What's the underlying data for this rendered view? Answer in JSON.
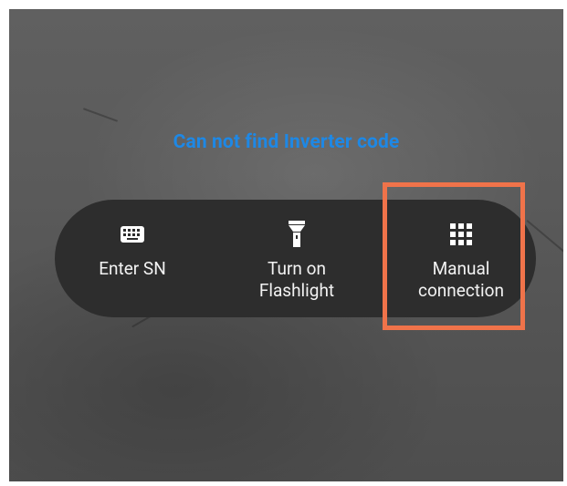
{
  "scanner": {
    "hint_text": "Can not find Inverter code",
    "hint_color": "#1e88e5"
  },
  "actions": [
    {
      "label": "Enter SN",
      "icon": "keyboard-icon"
    },
    {
      "label": "Turn on\nFlashlight",
      "icon": "flashlight-icon"
    },
    {
      "label": "Manual\nconnection",
      "icon": "grid-icon"
    }
  ],
  "highlight_color": "#f0734a"
}
